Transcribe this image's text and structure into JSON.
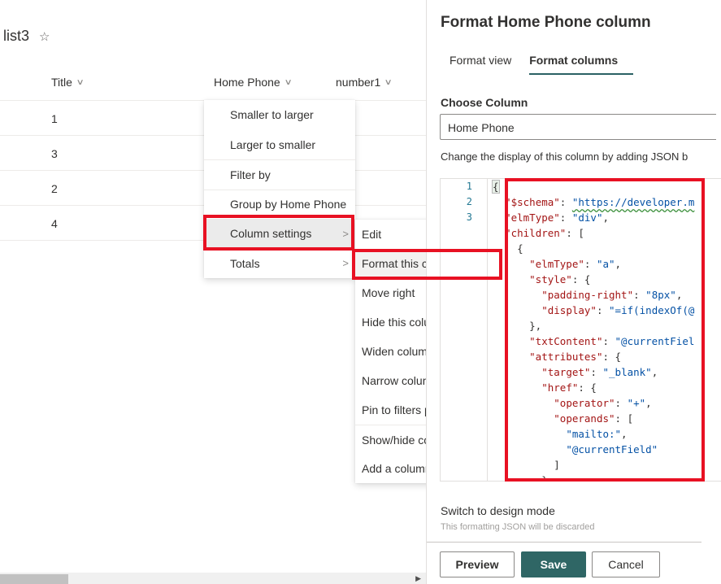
{
  "list": {
    "title": "list3",
    "favorite_icon": "☆",
    "columns": [
      {
        "label": "Title",
        "chevron": "∨"
      },
      {
        "label": "Home Phone",
        "chevron": "∨"
      },
      {
        "label": "number1",
        "chevron": "∨"
      }
    ],
    "rows": [
      {
        "title": "1"
      },
      {
        "title": "3"
      },
      {
        "title": "2"
      },
      {
        "title": "4"
      }
    ]
  },
  "column_menu": {
    "items": [
      {
        "label": "Smaller to larger"
      },
      {
        "label": "Larger to smaller"
      },
      {
        "label": "Filter by"
      },
      {
        "label": "Group by Home Phone"
      },
      {
        "label": "Column settings",
        "submenu_arrow": ">"
      },
      {
        "label": "Totals",
        "submenu_arrow": ">"
      }
    ]
  },
  "column_settings_submenu": {
    "items": [
      {
        "label": "Edit"
      },
      {
        "label": "Format this column"
      },
      {
        "label": "Move right"
      },
      {
        "label": "Hide this column"
      },
      {
        "label": "Widen column"
      },
      {
        "label": "Narrow column"
      },
      {
        "label": "Pin to filters pane"
      },
      {
        "label": "Show/hide columns"
      },
      {
        "label": "Add a column"
      }
    ]
  },
  "panel": {
    "title": "Format Home Phone column",
    "tabs": [
      {
        "label": "Format view"
      },
      {
        "label": "Format columns",
        "selected": true
      }
    ],
    "choose_column_label": "Choose Column",
    "choose_column_value": "Home Phone",
    "description": "Change the display of this column by adding JSON b",
    "editor": {
      "line_numbers": [
        "1",
        "2",
        "3"
      ],
      "lines": [
        "{",
        "  \"$schema\": \"https://developer.m",
        "  \"elmType\": \"div\",",
        "  \"children\": [",
        "    {",
        "      \"elmType\": \"a\",",
        "      \"style\": {",
        "        \"padding-right\": \"8px\",",
        "        \"display\": \"=if(indexOf(@",
        "      },",
        "      \"txtContent\": \"@currentFiel",
        "      \"attributes\": {",
        "        \"target\": \"_blank\",",
        "        \"href\": {",
        "          \"operator\": \"+\",",
        "          \"operands\": [",
        "            \"mailto:\",",
        "            \"@currentField\"",
        "          ]",
        "        }"
      ]
    },
    "switch_mode_link": "Switch to design mode",
    "discard_note": "This formatting JSON will be discarded",
    "buttons": {
      "preview": "Preview",
      "save": "Save",
      "cancel": "Cancel"
    }
  },
  "scrollbar": {
    "right_arrow": "▶"
  },
  "colors": {
    "accent": "#2f6665",
    "highlight_box": "#e81123",
    "json_key": "#a31515",
    "json_string": "#0451a5",
    "line_number": "#237893"
  }
}
